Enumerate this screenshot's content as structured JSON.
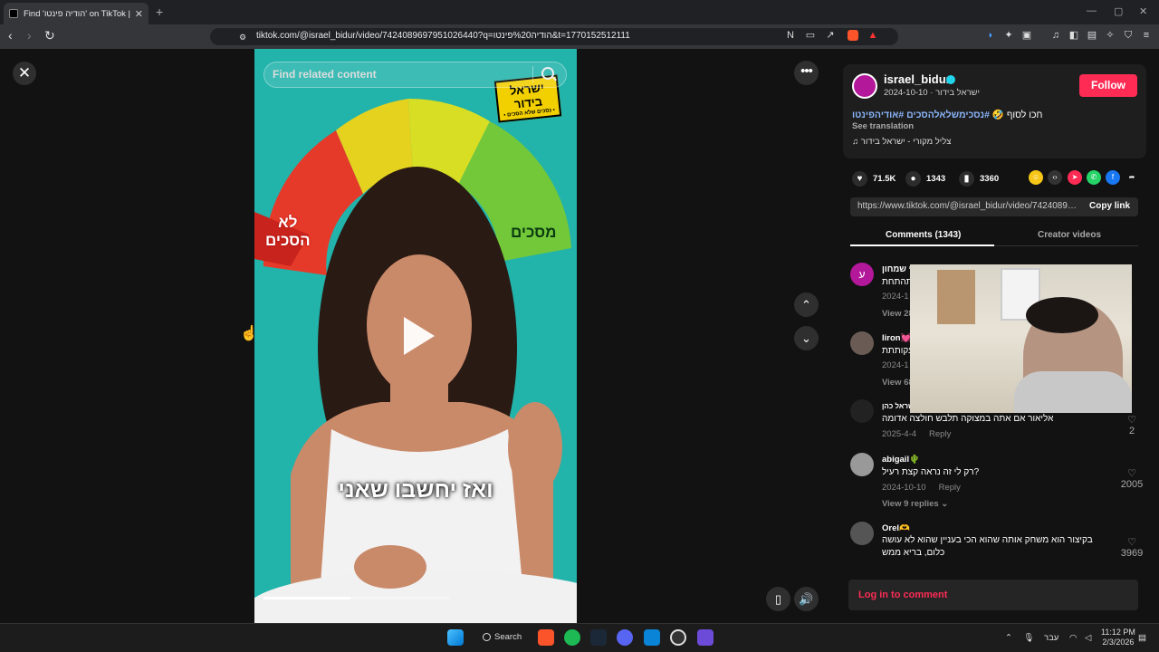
{
  "browser": {
    "tab_title": "Find 'הודיה פינטו' on TikTok | Tik",
    "url": "tiktok.com/@israel_bidur/video/7424089697951026440?q=הודיה%20פינטו&t=1770152512111"
  },
  "video": {
    "search_placeholder": "Find related content",
    "caption": "ואז יחשבו שאני",
    "label_left": "לא\nהסכים",
    "label_right": "מסכים",
    "logo_main": "ישראל בידור",
    "logo_sub": "• נסכים שלא הסכים •",
    "progress_fraction": 0.47
  },
  "author": {
    "username": "israel_bidur",
    "display_name": "ישראל בידור",
    "date": "2024-10-10",
    "follow_label": "Follow",
    "description_text": "חכו לסוף 🤣",
    "hashtags": "#נסכימשלאלהסכים #אודיהפינטו",
    "see_translation": "See translation",
    "music": "צליל מקורי - ישראל בידור",
    "avatar_color": "#b3179a",
    "accent_color": "#fe2c55"
  },
  "stats": {
    "likes": "71.5K",
    "comments": "1343",
    "saves": "3360"
  },
  "link": {
    "url": "https://www.tiktok.com/@israel_bidur/video/74240896...",
    "copy_label": "Copy link"
  },
  "tabs": {
    "comments": "Comments (1343)",
    "creator": "Creator videos"
  },
  "comments": [
    {
      "name": "עירי שמחון",
      "text": "ואתהתחת",
      "date": "2024-1",
      "replies": "View 28"
    },
    {
      "name": "liron💓",
      "text": "עקותתת",
      "date": "2024-1",
      "replies": "View 68"
    },
    {
      "name": "ישראל כהן",
      "text": "אליאור אם אתה במצוקה תלבש חולצה אדומה",
      "date": "2025-4-4",
      "reply": "Reply",
      "likes": "2"
    },
    {
      "name": "abigail🌵",
      "text": "רק לי זה נראה קצת רעיל?",
      "date": "2024-10-10",
      "reply": "Reply",
      "replies": "View 9 replies",
      "likes": "2005"
    },
    {
      "name": "Orel🫶",
      "text": "בקיצור הוא משחק אותה שהוא הכי בעניין שהוא לא עושה",
      "text2": "כלום, בריא ממש",
      "likes": "3969"
    }
  ],
  "login_label": "Log in to comment",
  "taskbar": {
    "search_label": "Search",
    "lang": "עבר",
    "time": "11:12 PM",
    "date": "2/3/2026"
  }
}
